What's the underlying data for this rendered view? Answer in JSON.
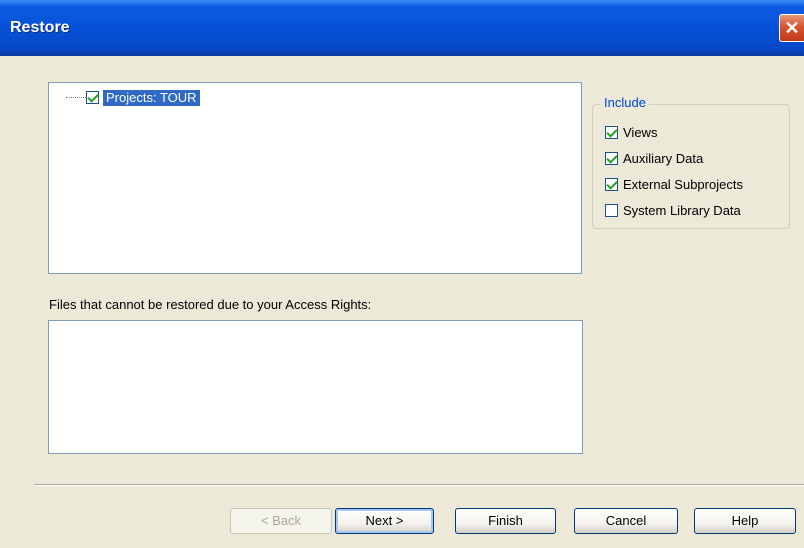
{
  "window": {
    "title": "Restore",
    "close_glyph": "✕"
  },
  "tree": {
    "root": {
      "label": "Projects: TOUR",
      "checked": true
    }
  },
  "files": {
    "label": "Files that cannot be restored due to your Access Rights:",
    "items": []
  },
  "include": {
    "legend": "Include",
    "options": [
      {
        "label": "Views",
        "checked": true
      },
      {
        "label": "Auxiliary Data",
        "checked": true
      },
      {
        "label": "External Subprojects",
        "checked": true
      },
      {
        "label": "System Library Data",
        "checked": false
      }
    ]
  },
  "buttons": {
    "back": "< Back",
    "next": "Next >",
    "finish": "Finish",
    "cancel": "Cancel",
    "help": "Help"
  }
}
